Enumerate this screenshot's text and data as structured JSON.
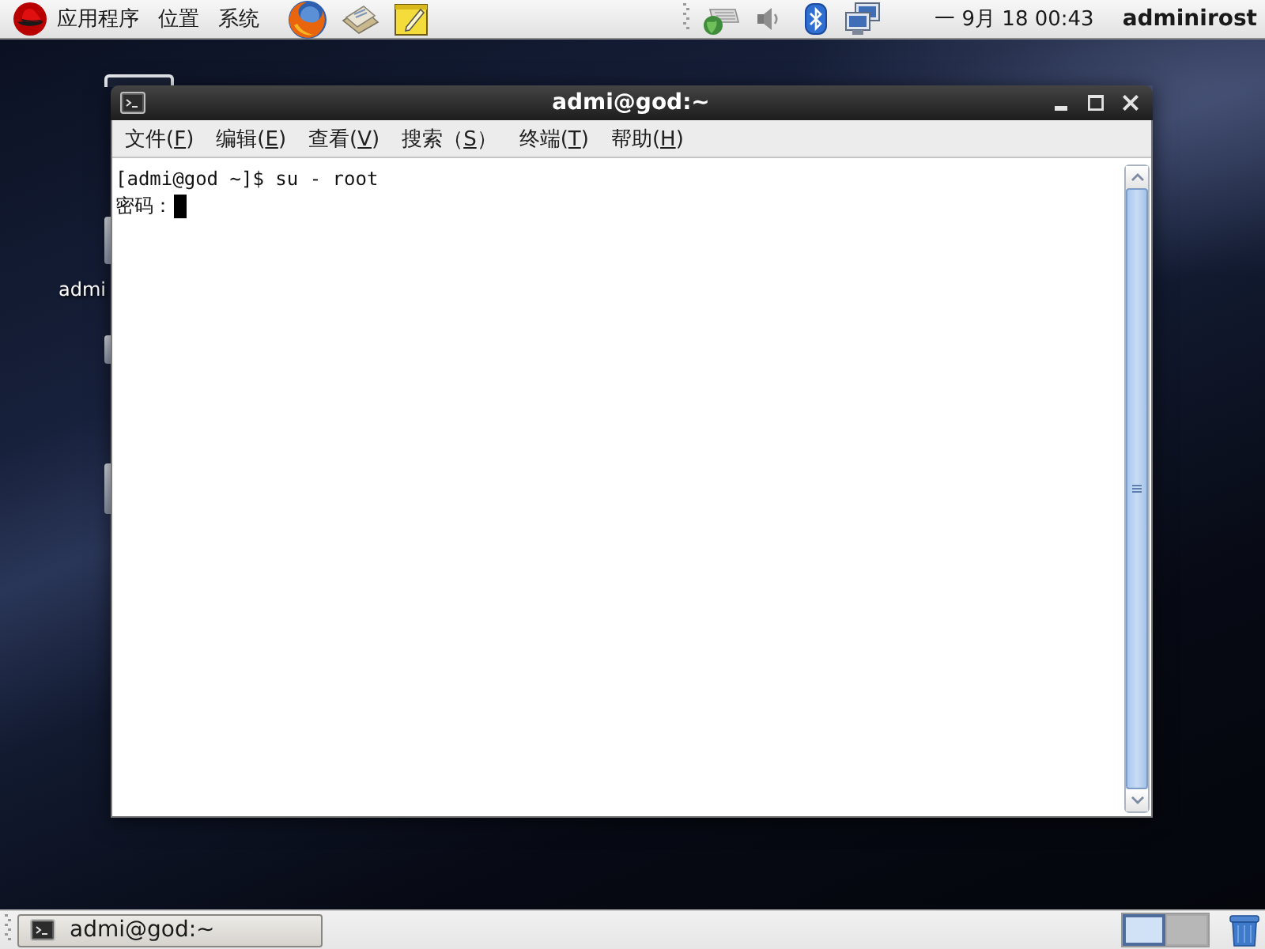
{
  "top_panel": {
    "menus": [
      "应用程序",
      "位置",
      "系统"
    ],
    "clock": "一 9月 18 00:43",
    "user": "adminirost"
  },
  "desktop": {
    "icon_label": "admi"
  },
  "window": {
    "title": "admi@god:~",
    "menu": [
      {
        "text": "文件(",
        "mnemonic": "F",
        "suffix": ")"
      },
      {
        "text": "编辑(",
        "mnemonic": "E",
        "suffix": ")"
      },
      {
        "text": "查看(",
        "mnemonic": "V",
        "suffix": ")"
      },
      {
        "text": "搜索（",
        "mnemonic": "S",
        "suffix": "）"
      },
      {
        "text": "终端(",
        "mnemonic": "T",
        "suffix": ")"
      },
      {
        "text": "帮助(",
        "mnemonic": "H",
        "suffix": ")"
      }
    ],
    "terminal_lines": [
      "[admi@god ~]$ su - root",
      "密码："
    ]
  },
  "bottom_panel": {
    "tasks": [
      {
        "label": "admi@god:~"
      }
    ],
    "workspaces": [
      {
        "selected": true
      },
      {
        "selected": false
      }
    ]
  }
}
